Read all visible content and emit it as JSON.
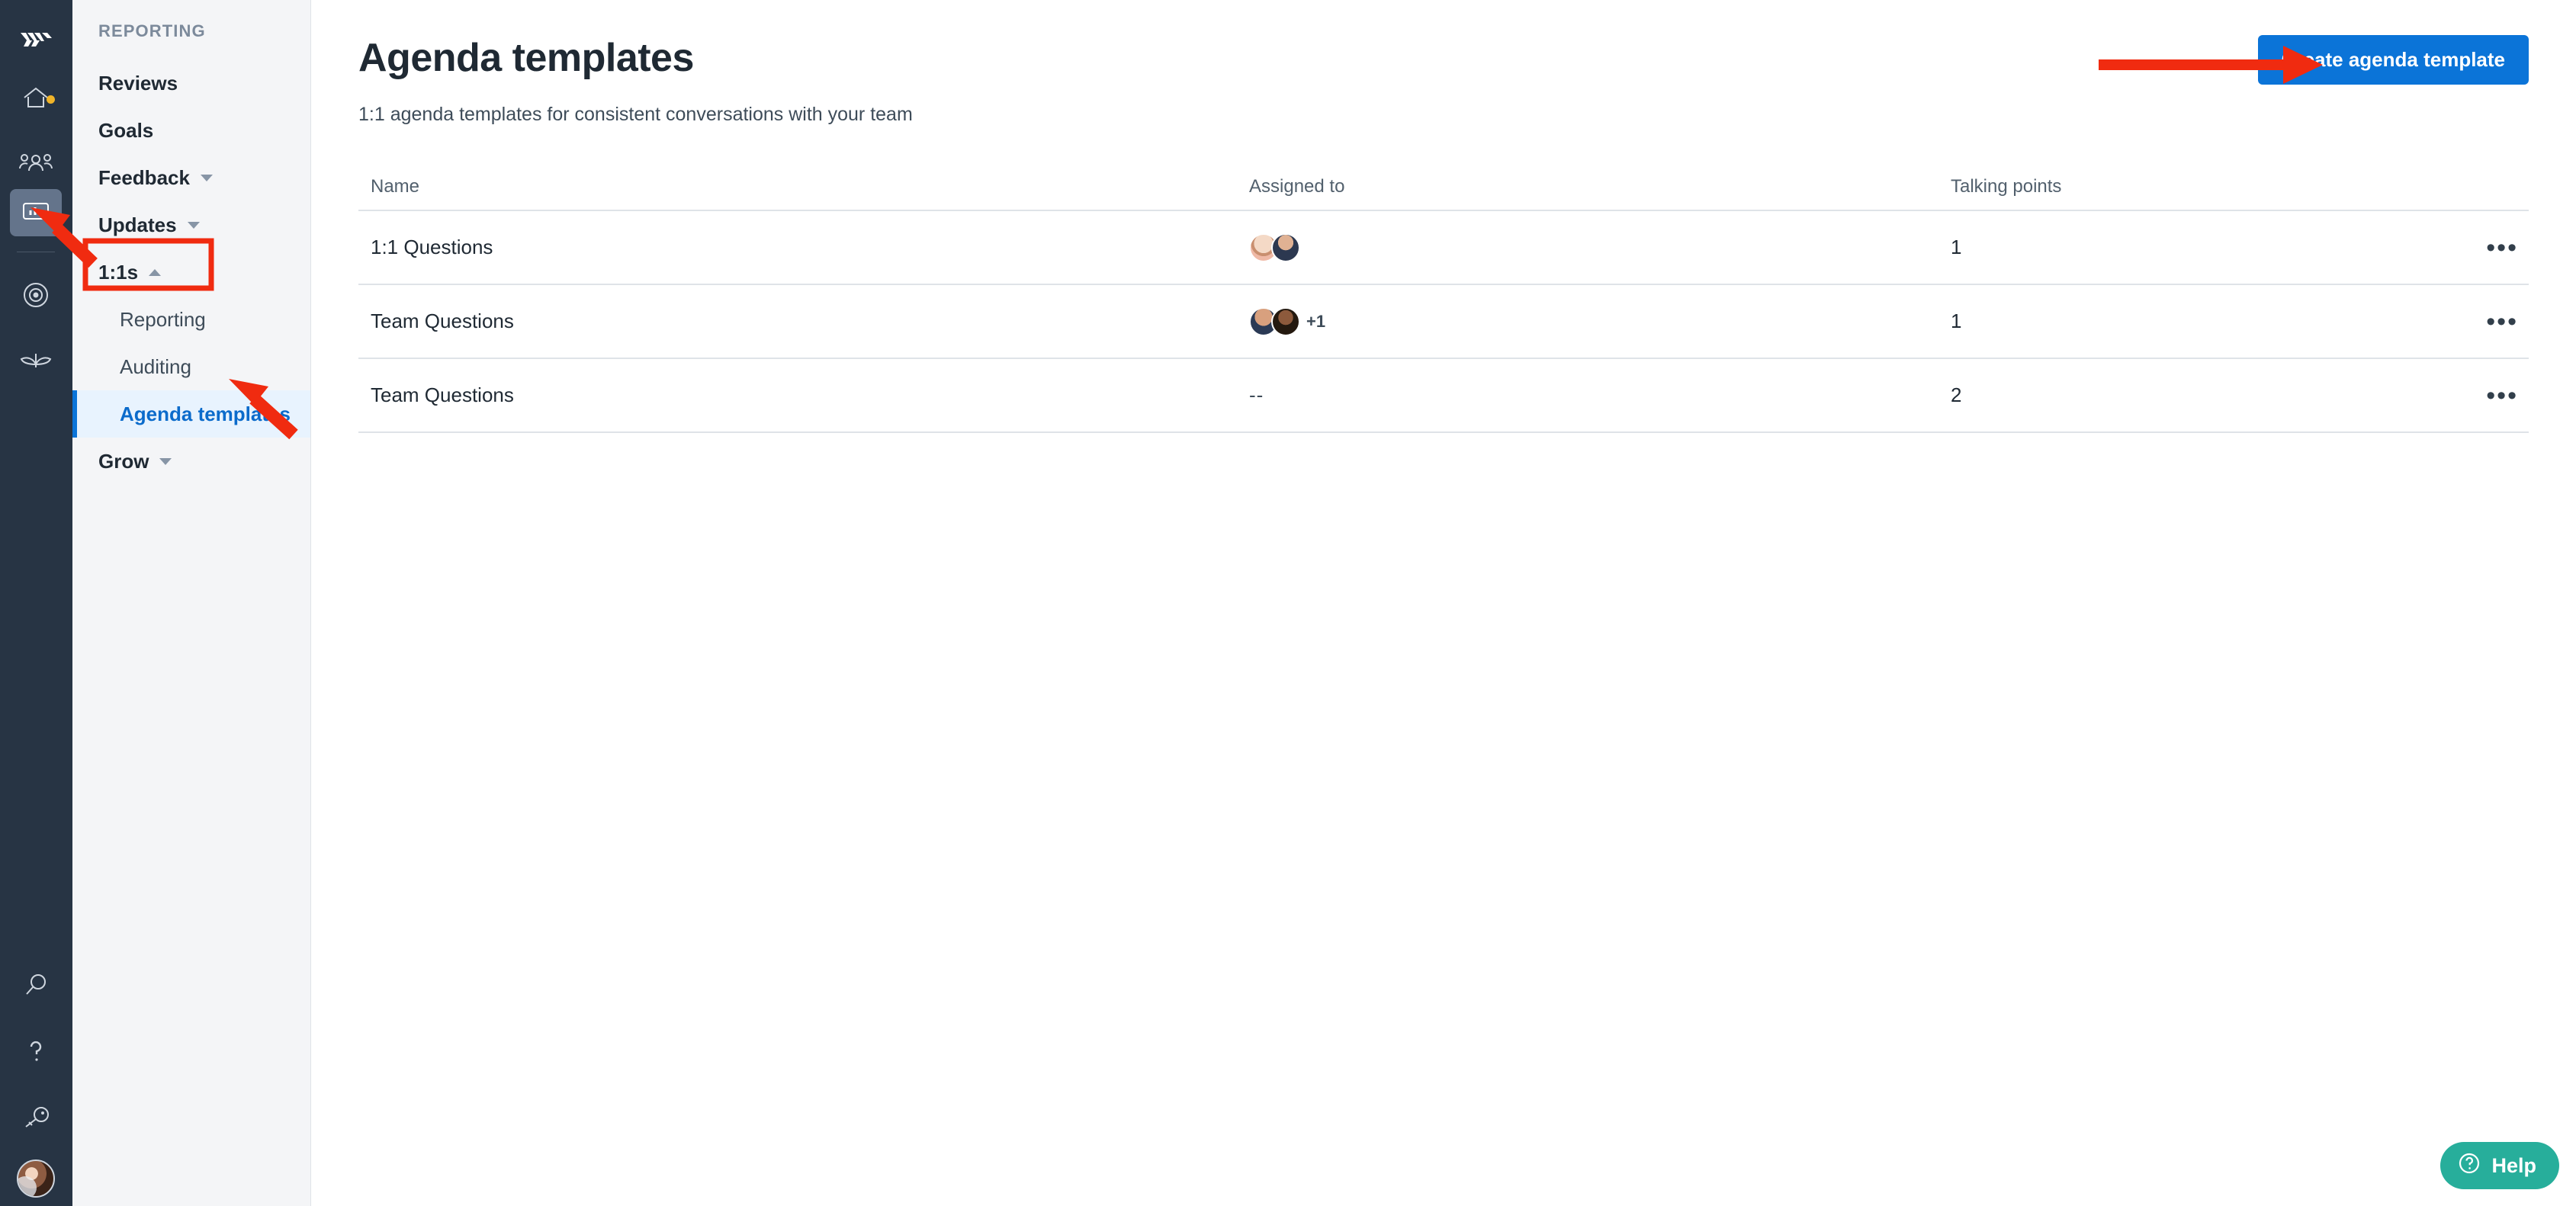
{
  "rail": {
    "logo_name": "company-logo",
    "items": [
      {
        "name": "home-icon",
        "icon": "home",
        "badge": true,
        "active": false
      },
      {
        "name": "people-icon",
        "icon": "people",
        "badge": false,
        "active": false
      },
      {
        "name": "reporting-icon",
        "icon": "chart",
        "badge": false,
        "active": true
      },
      {
        "name": "target-icon",
        "icon": "target",
        "badge": false,
        "active": false
      },
      {
        "name": "grow-icon",
        "icon": "plant",
        "badge": false,
        "active": false
      }
    ],
    "bottom_items": [
      {
        "name": "search-icon",
        "icon": "search"
      },
      {
        "name": "help-icon",
        "icon": "question"
      },
      {
        "name": "key-icon",
        "icon": "key"
      }
    ],
    "avatar_name": "user-avatar"
  },
  "sidebar": {
    "section_label": "REPORTING",
    "items": [
      {
        "label": "Reviews",
        "expandable": false,
        "expanded": false
      },
      {
        "label": "Goals",
        "expandable": false,
        "expanded": false
      },
      {
        "label": "Feedback",
        "expandable": true,
        "expanded": false
      },
      {
        "label": "Updates",
        "expandable": true,
        "expanded": false
      },
      {
        "label": "1:1s",
        "expandable": true,
        "expanded": true
      }
    ],
    "sub_items": [
      {
        "label": "Reporting",
        "selected": false
      },
      {
        "label": "Auditing",
        "selected": false
      },
      {
        "label": "Agenda templates",
        "selected": true
      }
    ],
    "trailing_items": [
      {
        "label": "Grow",
        "expandable": true,
        "expanded": false
      }
    ]
  },
  "main": {
    "title": "Agenda templates",
    "subtitle": "1:1 agenda templates for consistent conversations with your team",
    "create_button": "Create agenda template",
    "table": {
      "columns": [
        "Name",
        "Assigned to",
        "Talking points"
      ],
      "rows": [
        {
          "name": "1:1 Questions",
          "assigned_avatars": 2,
          "assigned_extra": "",
          "assigned_text": "",
          "talking_points": "1",
          "menu": "•••"
        },
        {
          "name": "Team Questions",
          "assigned_avatars": 2,
          "assigned_extra": "+1",
          "assigned_text": "",
          "talking_points": "1",
          "menu": "•••"
        },
        {
          "name": "Team Questions",
          "assigned_avatars": 0,
          "assigned_extra": "",
          "assigned_text": "--",
          "talking_points": "2",
          "menu": "•••"
        }
      ]
    }
  },
  "help_widget": {
    "label": "Help"
  },
  "colors": {
    "rail_bg": "#273444",
    "sidebar_bg": "#f4f5f7",
    "accent_blue": "#0b74d8",
    "selected_bg": "#e8f3fe",
    "help_green": "#27ae9b",
    "annotation_red": "#f02b10",
    "badge_yellow": "#f0b429"
  }
}
